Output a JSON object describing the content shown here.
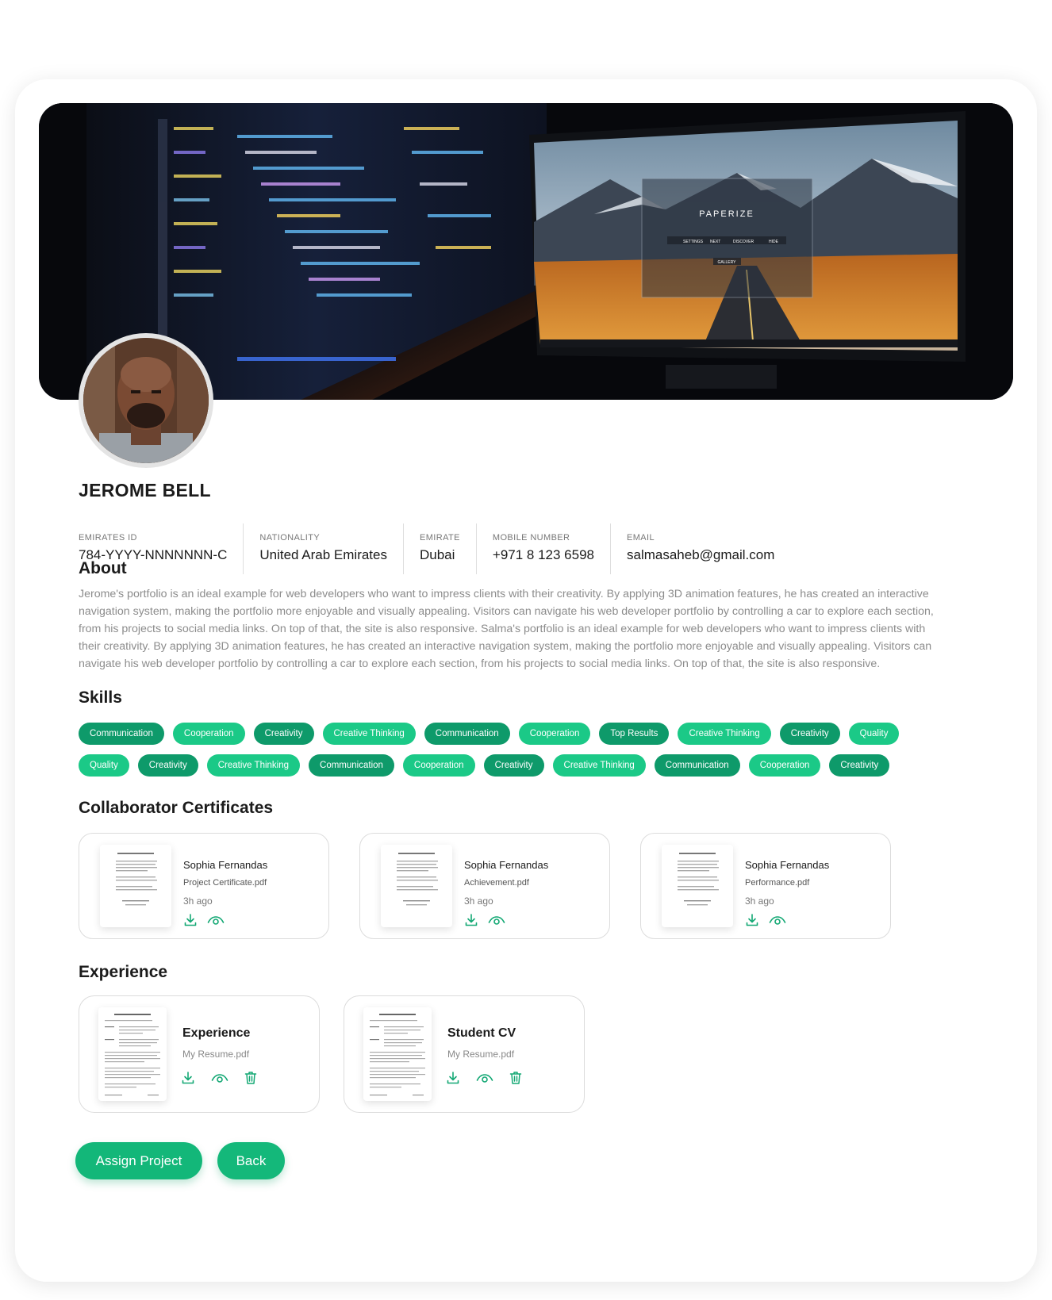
{
  "profile": {
    "name": "JEROME BELL"
  },
  "info": [
    {
      "label": "EMIRATES ID",
      "value": "784-YYYY-NNNNNNN-C"
    },
    {
      "label": "NATIONALITY",
      "value": "United Arab Emirates"
    },
    {
      "label": "EMIRATE",
      "value": "Dubai"
    },
    {
      "label": "MOBILE NUMBER",
      "value": "+971 8 123 6598"
    },
    {
      "label": "EMAIL",
      "value": "salmasaheb@gmail.com"
    }
  ],
  "about": {
    "title": "About",
    "text": "Jerome's portfolio is an ideal example for web developers who want to impress clients with their creativity. By applying 3D animation features, he has created an interactive navigation system, making the portfolio more enjoyable and visually appealing. Visitors can navigate his web developer portfolio by controlling a car to explore each section, from his projects to social media links. On top of that, the site is also responsive. Salma's portfolio is an ideal example for web developers who want to impress clients with their creativity. By applying 3D animation features, he has created an interactive navigation system, making the portfolio more enjoyable and visually appealing. Visitors can navigate his web developer portfolio by controlling a car to explore each section, from his projects to social media links. On top of that, the site is also responsive."
  },
  "skills": {
    "title": "Skills",
    "row1": [
      "Communication",
      "Cooperation",
      "Creativity",
      "Creative Thinking",
      "Communication",
      "Cooperation",
      "Top Results",
      "Creative Thinking",
      "Creativity",
      "Quality"
    ],
    "row2": [
      "Quality",
      "Creativity",
      "Creative Thinking",
      "Communication",
      "Cooperation",
      "Creativity",
      "Creative Thinking",
      "Communication",
      "Cooperation",
      "Creativity"
    ]
  },
  "certificates": {
    "title": "Collaborator Certificates",
    "items": [
      {
        "name": "Sophia Fernandas",
        "file": "Project Certificate.pdf",
        "time": "3h ago"
      },
      {
        "name": "Sophia Fernandas",
        "file": "Achievement.pdf",
        "time": "3h ago"
      },
      {
        "name": "Sophia Fernandas",
        "file": "Performance.pdf",
        "time": "3h ago"
      }
    ]
  },
  "experience": {
    "title": "Experience",
    "items": [
      {
        "title": "Experience",
        "file": "My Resume.pdf"
      },
      {
        "title": "Student CV",
        "file": "My Resume.pdf"
      }
    ]
  },
  "banner": {
    "screen_title": "PAPERIZE",
    "screen_menu": [
      "SETTINGS",
      "NEXT",
      "DISCOVER",
      "HIDE"
    ],
    "screen_button": "GALLERY"
  },
  "actions": {
    "assign_label": "Assign Project",
    "back_label": "Back"
  },
  "colors": {
    "accent": "#13b779",
    "chip_light": "#1bc987",
    "chip_dark": "#0e9a6a"
  }
}
